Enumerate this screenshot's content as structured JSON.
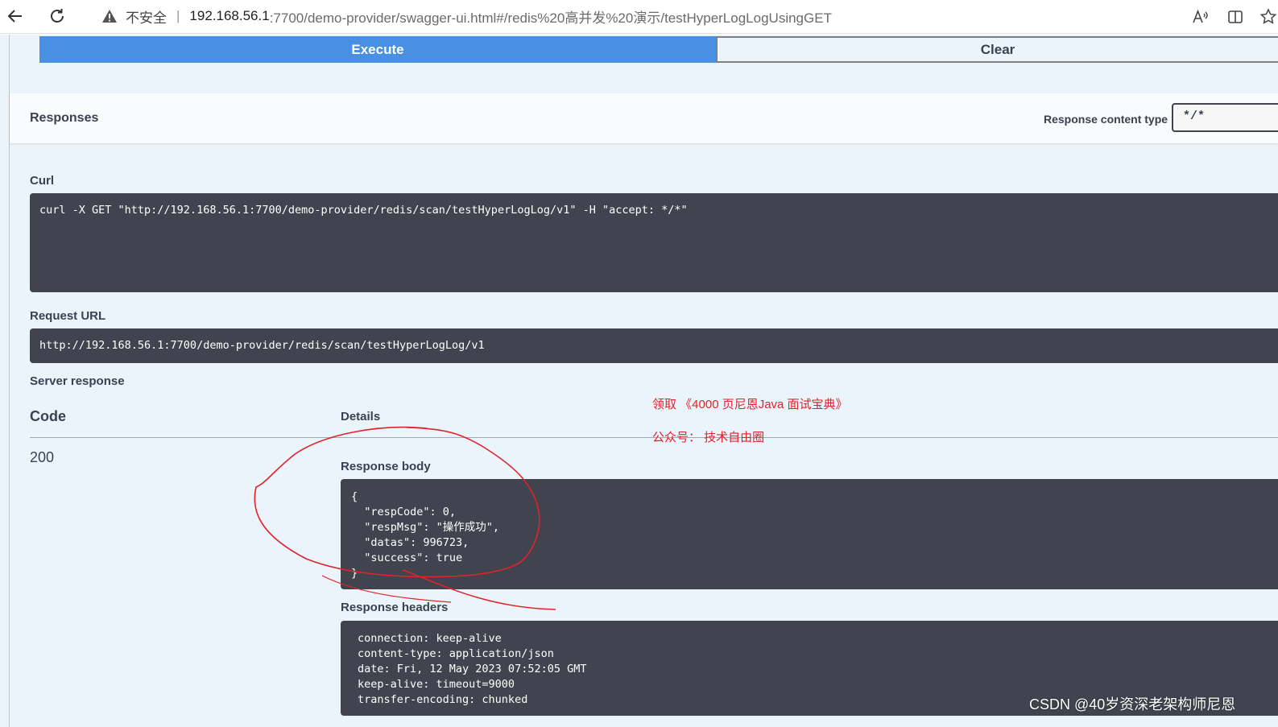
{
  "browser": {
    "security_label": "不安全",
    "url_host": "192.168.56.1",
    "url_rest": ":7700/demo-provider/swagger-ui.html#/redis%20高并发%20演示/testHyperLogLogUsingGET",
    "icons": [
      "back-arrow-icon",
      "reload-icon",
      "warning-icon",
      "read-aloud-icon",
      "split-screen-icon",
      "favorites-icon"
    ]
  },
  "actions": {
    "execute_label": "Execute",
    "clear_label": "Clear"
  },
  "responses": {
    "title": "Responses",
    "content_type_label": "Response content type",
    "content_type_value": "*/*"
  },
  "curl": {
    "label": "Curl",
    "command": "curl -X GET \"http://192.168.56.1:7700/demo-provider/redis/scan/testHyperLogLog/v1\" -H \"accept: */*\""
  },
  "request_url": {
    "label": "Request URL",
    "value": "http://192.168.56.1:7700/demo-provider/redis/scan/testHyperLogLog/v1"
  },
  "server_response": {
    "label": "Server response",
    "code_header": "Code",
    "details_header": "Details",
    "code": "200",
    "body_label": "Response body",
    "body": "{\n  \"respCode\": 0,\n  \"respMsg\": \"操作成功\",\n  \"datas\": 996723,\n  \"success\": true\n}",
    "headers_label": "Response headers",
    "headers": "connection: keep-alive\ncontent-type: application/json\ndate: Fri, 12 May 2023 07:52:05 GMT\nkeep-alive: timeout=9000\ntransfer-encoding: chunked"
  },
  "annotations": {
    "note_line1": "领取 《4000 页尼恩Java 面试宝典》",
    "note_line2": "公众号： 技术自由圈",
    "watermark": "CSDN @40岁资深老架构师尼恩",
    "ink_color": "#e0232a"
  },
  "colors": {
    "execute_bg": "#4990e2",
    "page_bg": "#ebf3fb",
    "code_bg": "#41444e"
  }
}
